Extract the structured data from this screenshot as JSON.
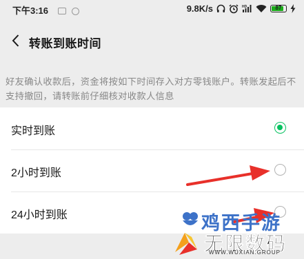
{
  "status_bar": {
    "time": "下午3:16",
    "network_speed": "9.8K/s",
    "battery_level": "87",
    "icons": [
      "message-icon",
      "notification-icon",
      "headphones-icon",
      "alarm-icon",
      "hd-signal-icon",
      "wifi-icon",
      "battery-icon",
      "charging-icon"
    ]
  },
  "nav": {
    "back_icon": "chevron-left-icon",
    "title": "转账到账时间"
  },
  "note": "好友确认收款后，资金将按如下时间存入对方零钱账户。转账发起后不支持撤回，请转账前仔细核对收款人信息",
  "options": [
    {
      "label": "实时到账",
      "selected": true
    },
    {
      "label": "2小时到账",
      "selected": false
    },
    {
      "label": "24小时到账",
      "selected": false
    }
  ],
  "colors": {
    "accent": "#07c160",
    "arrow": "#e8302a",
    "background": "#ededed"
  },
  "watermark": {
    "top_text": "鸡西手游",
    "main_text": "无限数码",
    "sub_text": "WWW.WUXIAN.GROUP"
  }
}
